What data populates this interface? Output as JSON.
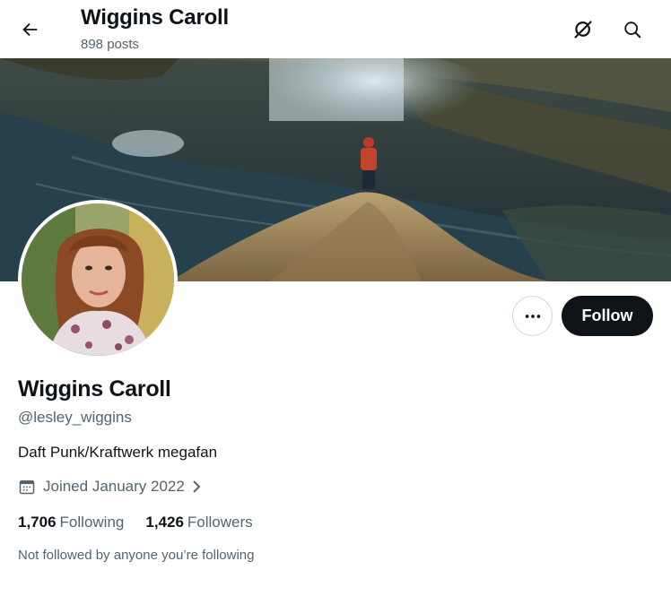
{
  "header": {
    "title": "Wiggins Caroll",
    "post_count": "898 posts"
  },
  "icons": {
    "back": "arrow-left-icon",
    "grok": "grok-icon",
    "search": "search-icon",
    "more": "more-dots-icon",
    "calendar": "calendar-icon",
    "chevron": "chevron-right-icon"
  },
  "profile": {
    "display_name": "Wiggins Caroll",
    "handle": "@lesley_wiggins",
    "bio": "Daft Punk/Kraftwerk megafan",
    "joined": "Joined January 2022",
    "following_count": "1,706",
    "following_label": "Following",
    "followers_count": "1,426",
    "followers_label": "Followers",
    "mutuals_note": "Not followed by anyone you’re following"
  },
  "actions": {
    "follow_label": "Follow"
  },
  "colors": {
    "text_primary": "#0f1419",
    "text_secondary": "#536471",
    "follow_bg": "#0f1419",
    "border": "#cfd9de"
  }
}
